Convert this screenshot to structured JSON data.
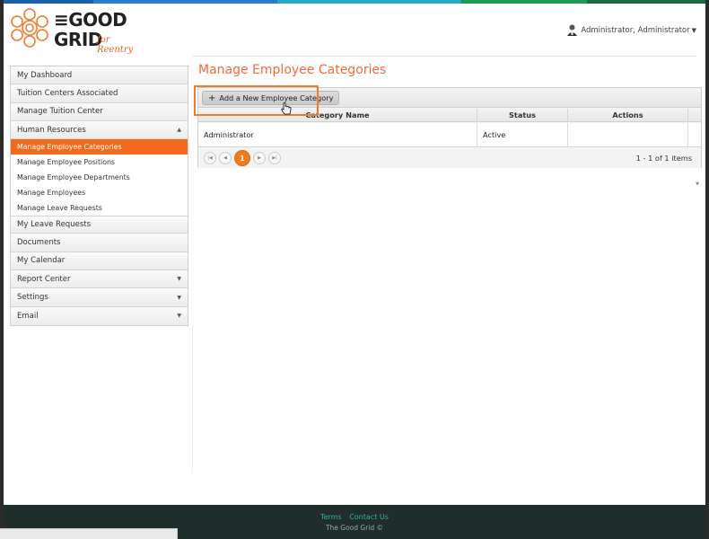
{
  "colors": {
    "accent": "#f26a1e",
    "title": "#f06a3a",
    "footer_bg": "#1f2d2b",
    "footer_link": "#2bb3a4"
  },
  "logo": {
    "line1": "≡GOOD",
    "line2": "GRID",
    "tagline": "for Reentry"
  },
  "user": {
    "name": "Administrator, Administrator",
    "icon": "user-avatar-icon"
  },
  "sidebar": {
    "items": [
      {
        "label": "My Dashboard"
      },
      {
        "label": "Tuition Centers Associated"
      },
      {
        "label": "Manage Tuition Center"
      },
      {
        "label": "Human Resources",
        "arrow": "▲"
      }
    ],
    "sub_items": [
      {
        "label": "Manage Employee Categories",
        "active": true
      },
      {
        "label": "Manage Employee Positions"
      },
      {
        "label": "Manage Employee Departments"
      },
      {
        "label": "Manage Employees"
      },
      {
        "label": "Manage Leave Requests"
      }
    ],
    "items_after": [
      {
        "label": "My Leave Requests"
      },
      {
        "label": "Documents"
      },
      {
        "label": "My Calendar"
      },
      {
        "label": "Report Center",
        "arrow": "▼"
      },
      {
        "label": "Settings",
        "arrow": "▼"
      },
      {
        "label": "Email",
        "arrow": "▼"
      }
    ]
  },
  "main": {
    "title": "Manage Employee Categories",
    "add_button": "Add a New Employee Category",
    "columns": [
      "Category Name",
      "Status",
      "Actions"
    ],
    "rows": [
      {
        "name": "Administrator",
        "status": "Active",
        "actions": ""
      }
    ],
    "pager": {
      "current": "1",
      "info": "1 - 1 of 1 items"
    }
  },
  "footer": {
    "terms": "Terms",
    "contact": "Contact Us",
    "copyright": "The Good Grid ©"
  }
}
